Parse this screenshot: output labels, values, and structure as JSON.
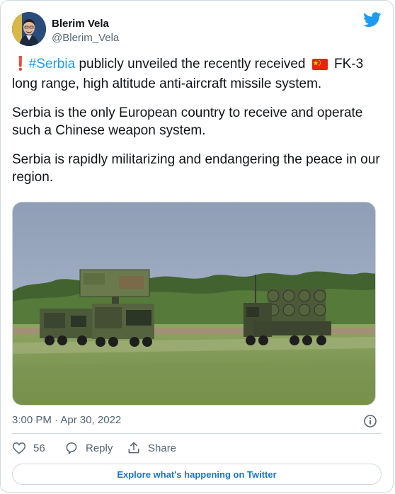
{
  "author": {
    "display_name": "Blerim Vela",
    "handle": "@Blerim_Vela"
  },
  "tweet": {
    "exclamation": "❗",
    "hashtag": "#Serbia",
    "line1_part1": " publicly unveiled the recently received ",
    "flag_icon": "china-flag-icon",
    "line1_part2": " FK-3 long range, high altitude anti-aircraft missile system.",
    "paragraph2": "Serbia is the only European country to receive and operate such a Chinese weapon system.",
    "paragraph3": "Serbia is rapidly militarizing and endangering the peace in our region."
  },
  "meta": {
    "timestamp": "3:00 PM · Apr 30, 2022"
  },
  "actions": {
    "like_count": "56",
    "reply_label": "Reply",
    "share_label": "Share"
  },
  "footer": {
    "explore_label": "Explore what's happening on Twitter"
  },
  "colors": {
    "accent": "#1d9bf0",
    "like_color": "#536471"
  }
}
